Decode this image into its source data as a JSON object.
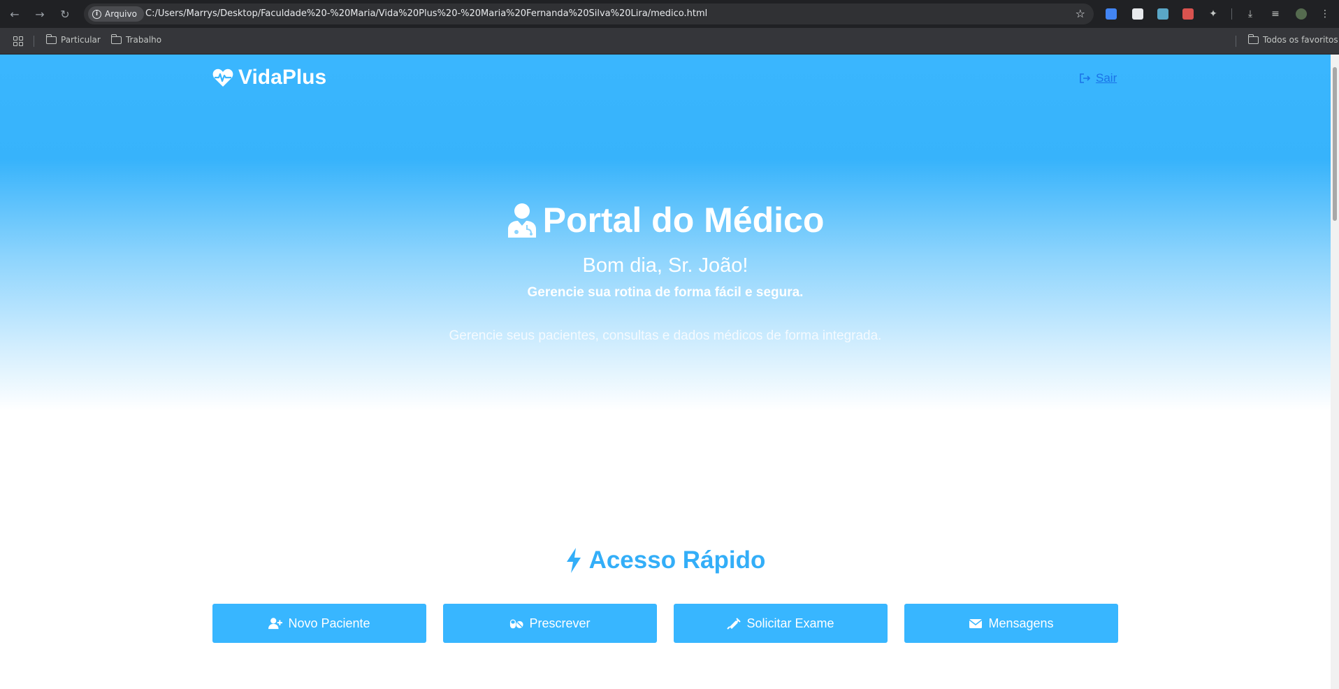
{
  "browser": {
    "chip_label": "Arquivo",
    "url": "C:/Users/Marrys/Desktop/Faculdade%20-%20Maria/Vida%20Plus%20-%20Maria%20Fernanda%20Silva%20Lira/medico.html",
    "bookmarks": [
      "Particular",
      "Trabalho"
    ],
    "all_bookmarks": "Todos os favoritos"
  },
  "header": {
    "brand": "VidaPlus",
    "logout_label": "Sair"
  },
  "hero": {
    "title": "Portal do Médico",
    "greeting": "Bom dia, Sr. João!",
    "subtitle": "Gerencie sua rotina de forma fácil e segura.",
    "description": "Gerencie seus pacientes, consultas e dados médicos de forma integrada."
  },
  "quick_access": {
    "title": "Acesso Rápido",
    "buttons": [
      {
        "label": "Novo Paciente",
        "icon": "user-plus-icon"
      },
      {
        "label": "Prescrever",
        "icon": "pills-icon"
      },
      {
        "label": "Solicitar Exame",
        "icon": "syringe-icon"
      },
      {
        "label": "Mensagens",
        "icon": "envelope-icon"
      }
    ]
  },
  "colors": {
    "accent": "#38b6ff",
    "title_blue": "#33aef8",
    "link": "#1a73e8"
  }
}
